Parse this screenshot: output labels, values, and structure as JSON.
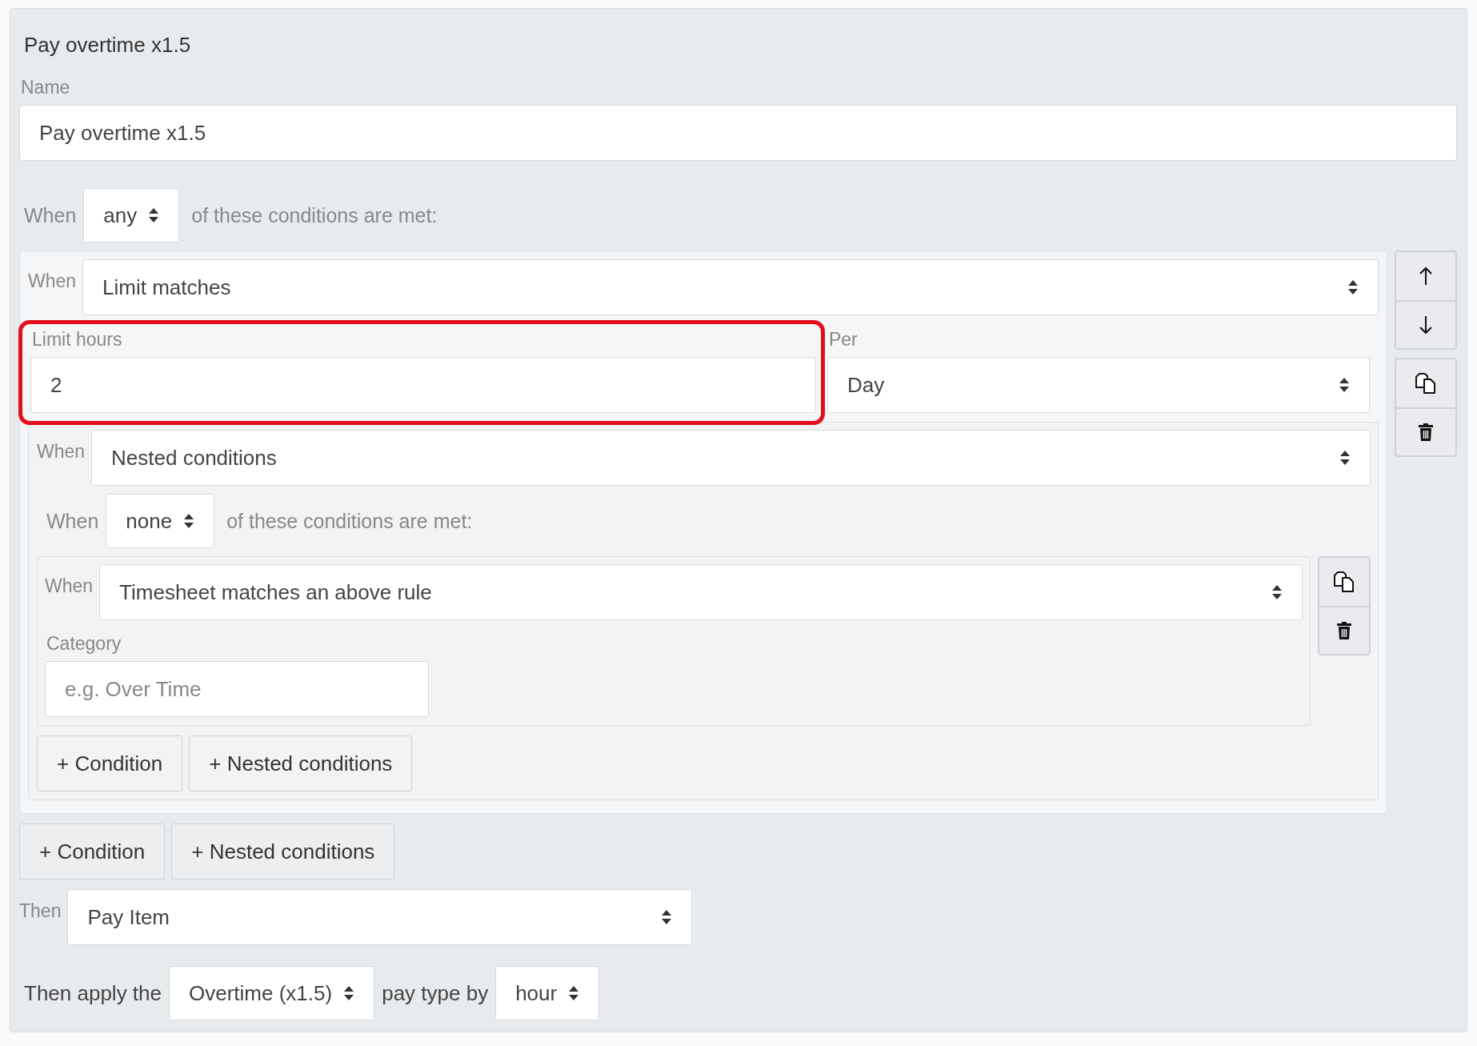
{
  "title": "Pay overtime x1.5",
  "name_field": {
    "label": "Name",
    "value": "Pay overtime x1.5"
  },
  "match": {
    "prefix": "When",
    "value": "any",
    "suffix": "of these conditions are met:"
  },
  "rule_conditions": [
    {
      "when_label": "When",
      "type": "Limit matches",
      "movable": true,
      "fields": [
        {
          "kind": "text",
          "label": "Limit hours",
          "value": "2",
          "highlighted": true
        },
        {
          "kind": "select",
          "label": "Per",
          "value": "Day",
          "highlighted": false
        }
      ],
      "nested": {
        "when_label": "When",
        "type": "Nested conditions",
        "match": {
          "prefix": "When",
          "value": "none",
          "suffix": "of these conditions are met:"
        },
        "conditions": [
          {
            "when_label": "When",
            "type": "Timesheet matches an above rule",
            "movable": false,
            "fields": [
              {
                "kind": "placeholder",
                "label": "Category",
                "placeholder": "e.g. Over Time"
              }
            ]
          }
        ],
        "buttons": [
          "+ Condition",
          "+ Nested conditions"
        ]
      }
    }
  ],
  "add_buttons": [
    "+ Condition",
    "+ Nested conditions"
  ],
  "then": {
    "label": "Then",
    "value": "Pay Item"
  },
  "apply": {
    "prefix": "Then apply the",
    "pay_type": "Overtime (x1.5)",
    "middle": "pay type by",
    "unit": "hour"
  }
}
